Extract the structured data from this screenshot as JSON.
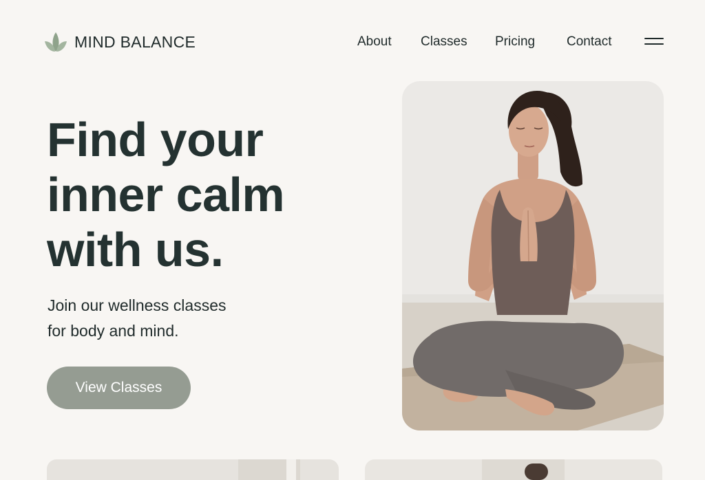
{
  "brand": {
    "name": "MIND BALANCE",
    "icon": "leaf-icon",
    "accent_color": "#8fa38b"
  },
  "nav": {
    "links": [
      {
        "label": "About"
      },
      {
        "label": "Classes"
      },
      {
        "label": "Pricing"
      },
      {
        "label": "Contact"
      }
    ],
    "menu_icon": "hamburger-menu-icon"
  },
  "hero": {
    "title_lines": [
      "Find your",
      "inner calm",
      "with us."
    ],
    "subtitle_lines": [
      "Join our wellness classes",
      "for body and mind."
    ],
    "cta_label": "View Classes",
    "cta_color": "#959c92",
    "image_subject": "yoga-meditation-photo"
  },
  "colors": {
    "background": "#f8f6f3",
    "heading": "#243231",
    "text": "#1f2a2a"
  }
}
